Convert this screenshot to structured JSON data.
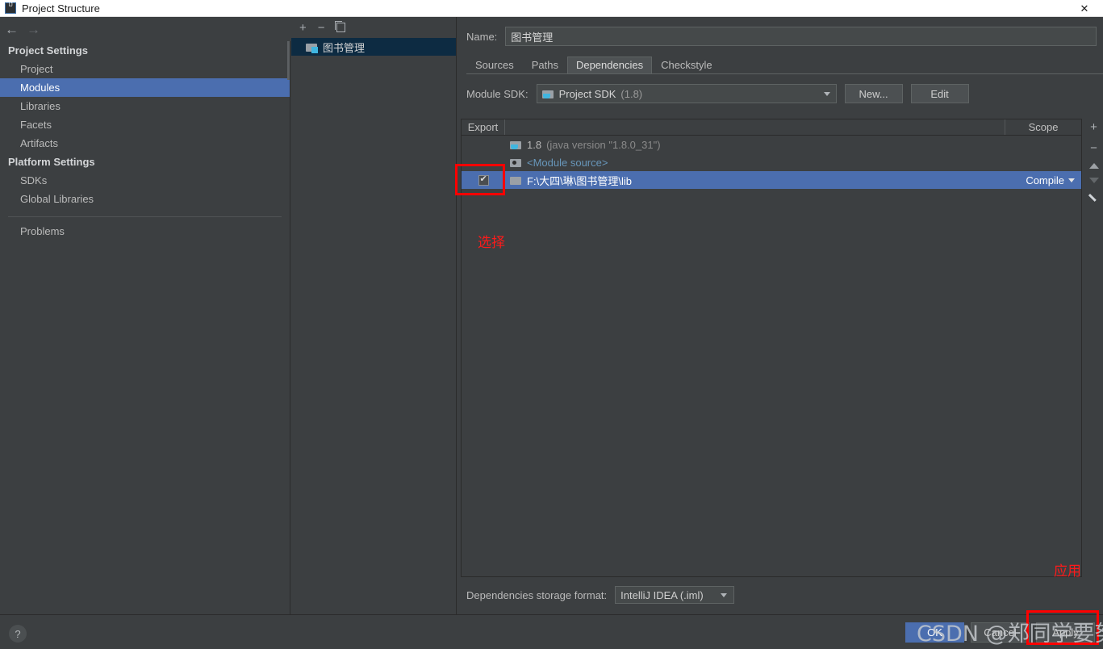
{
  "window": {
    "title": "Project Structure",
    "app_icon": "intellij-idea-icon",
    "close_label": "✕"
  },
  "nav": {
    "back_icon": "arrow-left-icon",
    "forward_icon": "arrow-right-icon"
  },
  "sidebar": {
    "groups": [
      {
        "label": "Project Settings",
        "items": [
          {
            "label": "Project",
            "selected": false
          },
          {
            "label": "Modules",
            "selected": true
          },
          {
            "label": "Libraries",
            "selected": false
          },
          {
            "label": "Facets",
            "selected": false
          },
          {
            "label": "Artifacts",
            "selected": false
          }
        ]
      },
      {
        "label": "Platform Settings",
        "items": [
          {
            "label": "SDKs",
            "selected": false
          },
          {
            "label": "Global Libraries",
            "selected": false
          }
        ]
      }
    ],
    "problems_label": "Problems"
  },
  "modules_panel": {
    "toolbar": {
      "add_label": "+",
      "remove_label": "−",
      "copy_icon": "copy-icon"
    },
    "items": [
      {
        "label": "图书管理",
        "icon": "module-icon",
        "selected": true
      }
    ]
  },
  "detail": {
    "name_label": "Name:",
    "name_value": "图书管理",
    "tabs": [
      {
        "label": "Sources",
        "active": false
      },
      {
        "label": "Paths",
        "active": false
      },
      {
        "label": "Dependencies",
        "active": true
      },
      {
        "label": "Checkstyle",
        "active": false
      }
    ],
    "module_sdk": {
      "label": "Module SDK:",
      "value": "Project SDK",
      "value_suffix": "(1.8)",
      "icon": "sdk-icon",
      "new_button": "New...",
      "edit_button": "Edit"
    },
    "table": {
      "columns": [
        "Export",
        "",
        "Scope"
      ],
      "rows": [
        {
          "export_checked": false,
          "export_visible": false,
          "icon": "sdk-icon",
          "name": "1.8",
          "name_suffix": "(java version \"1.8.0_31\")",
          "scope": "",
          "selected": false,
          "style": "sdk"
        },
        {
          "export_checked": false,
          "export_visible": false,
          "icon": "module-source-icon",
          "name": "<Module source>",
          "name_suffix": "",
          "scope": "",
          "selected": false,
          "style": "module-source"
        },
        {
          "export_checked": true,
          "export_visible": true,
          "icon": "folder-icon",
          "name": "F:\\大四\\琳\\图书管理\\lib",
          "name_suffix": "",
          "scope": "Compile",
          "selected": true,
          "style": "library"
        }
      ]
    },
    "side_toolbar": {
      "add_icon": "plus-icon",
      "remove_icon": "minus-icon",
      "move_up_icon": "arrow-up-icon",
      "move_down_icon": "arrow-down-icon",
      "edit_icon": "pencil-icon"
    },
    "storage": {
      "label": "Dependencies storage format:",
      "value": "IntelliJ IDEA (.iml)"
    }
  },
  "bottom": {
    "help_label": "?",
    "ok_label": "OK",
    "cancel_label": "Cancel",
    "apply_label": "Apply"
  },
  "annotations": {
    "select_text": "选择",
    "apply_text": "应用",
    "watermark": "CSDN @郑同学要努力",
    "accent_red": "#ff0000"
  }
}
